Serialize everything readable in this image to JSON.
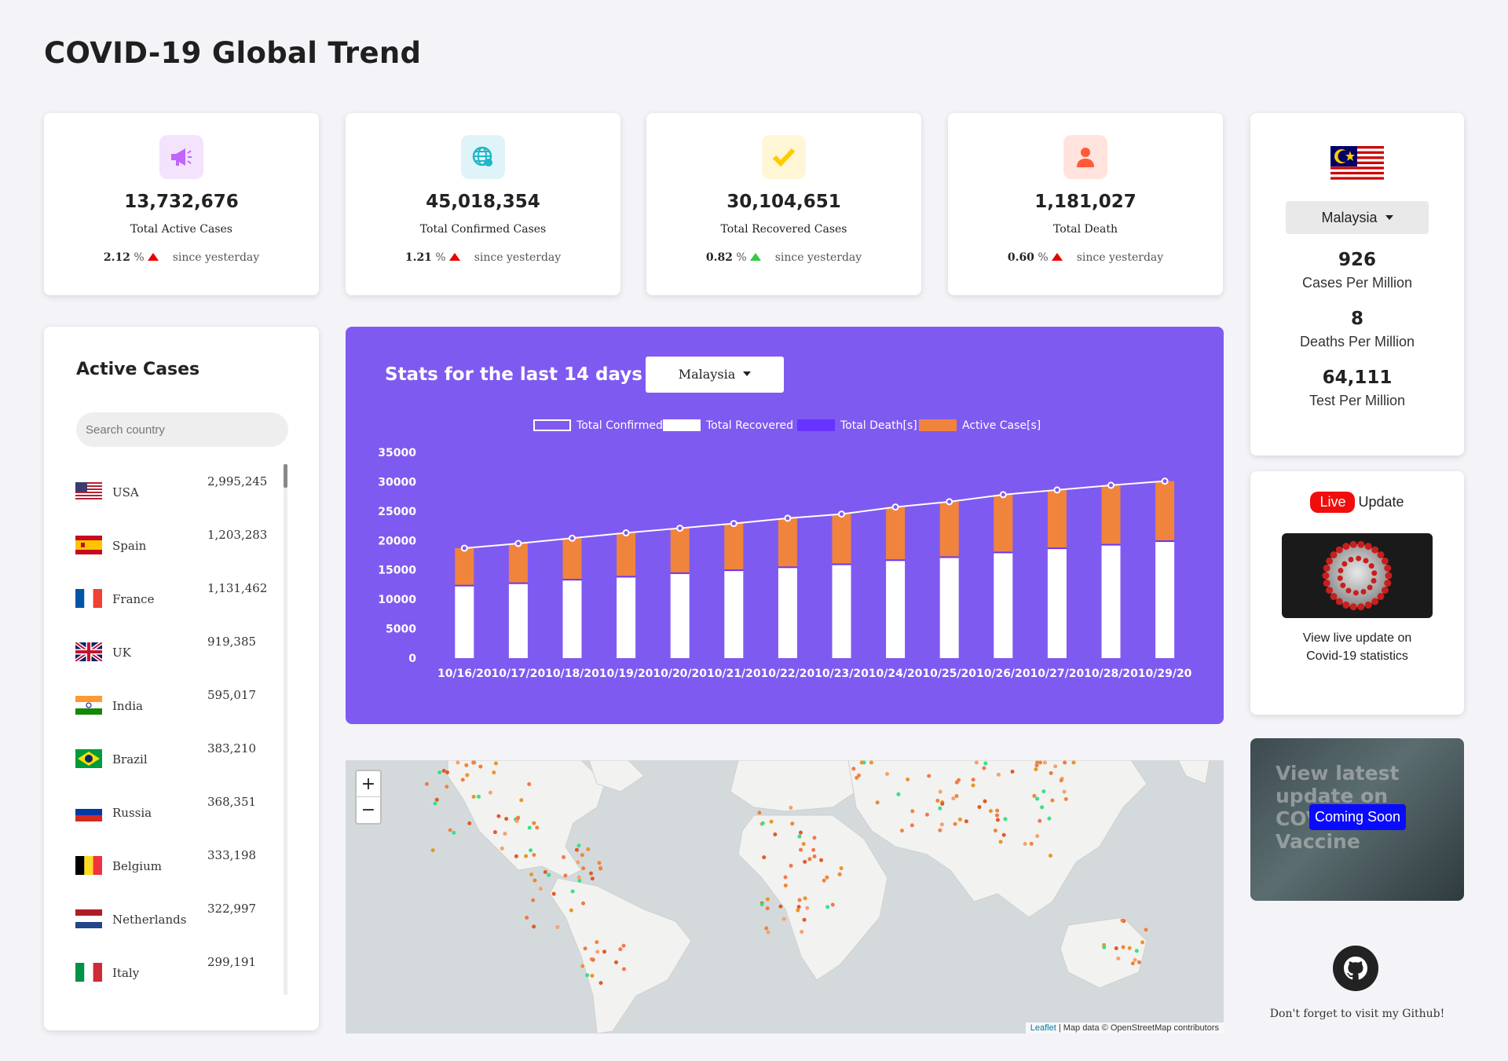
{
  "page_title": "COVID-19 Global Trend",
  "stats": [
    {
      "value": "13,732,676",
      "label": "Total Active Cases",
      "pct": "2.12",
      "since": "since yesterday",
      "icon": "megaphone-icon",
      "icon_color": "#c264fe",
      "icon_bg": "#f3e3fd",
      "trend_color": "#e60000"
    },
    {
      "value": "45,018,354",
      "label": "Total Confirmed Cases",
      "pct": "1.21",
      "since": "since yesterday",
      "icon": "globe-icon",
      "icon_color": "#1fb6c9",
      "icon_bg": "#dff4f8",
      "trend_color": "#e60000"
    },
    {
      "value": "30,104,651",
      "label": "Total Recovered Cases",
      "pct": "0.82",
      "since": "since yesterday",
      "icon": "check-icon",
      "icon_color": "#ffcc00",
      "icon_bg": "#fff6d6",
      "trend_color": "#2ecc40"
    },
    {
      "value": "1,181,027",
      "label": "Total Death",
      "pct": "0.60",
      "since": "since yesterday",
      "icon": "person-icon",
      "icon_color": "#ff5b3a",
      "icon_bg": "#ffe3dc",
      "trend_color": "#e60000"
    }
  ],
  "country_card": {
    "selected": "Malaysia",
    "cases_per_million": "926",
    "cases_label": "Cases Per Million",
    "deaths_per_million": "8",
    "deaths_label": "Deaths Per Million",
    "tests_per_million": "64,111",
    "tests_label": "Test Per Million"
  },
  "live": {
    "badge": "Live",
    "label": "Update",
    "line1": "View live update on",
    "line2": "Covid-19 statistics"
  },
  "vaccine": {
    "text_lines": [
      "View latest",
      "update on",
      "COVID-19",
      "Vaccine"
    ],
    "badge": "Coming Soon"
  },
  "github": {
    "text": "Don't forget to visit my Github!"
  },
  "active_cases": {
    "title": "Active Cases",
    "search_placeholder": "Search country",
    "rows": [
      {
        "country": "USA",
        "value": "2,995,245"
      },
      {
        "country": "Spain",
        "value": "1,203,283"
      },
      {
        "country": "France",
        "value": "1,131,462"
      },
      {
        "country": "UK",
        "value": "919,385"
      },
      {
        "country": "India",
        "value": "595,017"
      },
      {
        "country": "Brazil",
        "value": "383,210"
      },
      {
        "country": "Russia",
        "value": "368,351"
      },
      {
        "country": "Belgium",
        "value": "333,198"
      },
      {
        "country": "Netherlands",
        "value": "322,997"
      },
      {
        "country": "Italy",
        "value": "299,191"
      }
    ]
  },
  "chart_panel": {
    "title": "Stats for the last 14 days in",
    "selected": "Malaysia"
  },
  "chart_data": {
    "type": "bar",
    "categories": [
      "10/16/20",
      "10/17/20",
      "10/18/20",
      "10/19/20",
      "10/20/20",
      "10/21/20",
      "10/22/20",
      "10/23/20",
      "10/24/20",
      "10/25/20",
      "10/26/20",
      "10/27/20",
      "10/28/20",
      "10/29/20"
    ],
    "series": [
      {
        "name": "Total Confirmed",
        "kind": "line",
        "color": "#ffffff",
        "values": [
          18700,
          19500,
          20400,
          21300,
          22100,
          22900,
          23800,
          24500,
          25700,
          26600,
          27800,
          28600,
          29400,
          30100
        ]
      },
      {
        "name": "Total Recovered",
        "kind": "bar",
        "color": "#ffffff",
        "values": [
          12300,
          12700,
          13300,
          13800,
          14400,
          14900,
          15400,
          15900,
          16600,
          17100,
          17900,
          18600,
          19200,
          19800
        ]
      },
      {
        "name": "Total Death[s]",
        "kind": "bar",
        "color": "#6633ff",
        "values": [
          167,
          169,
          172,
          176,
          178,
          181,
          187,
          190,
          193,
          199,
          207,
          214,
          221,
          229
        ]
      },
      {
        "name": "Active Case[s]",
        "kind": "bar",
        "color": "#f0843c",
        "values": [
          6233,
          6631,
          6928,
          7324,
          7522,
          7819,
          8213,
          8410,
          8907,
          9301,
          9693,
          9786,
          9979,
          10071
        ]
      }
    ],
    "yticks": [
      "35000",
      "30000",
      "25000",
      "20000",
      "15000",
      "10000",
      "5000",
      "0"
    ],
    "ylim": [
      0,
      35000
    ],
    "legend": "top"
  },
  "map": {
    "zoom_in": "+",
    "zoom_out": "−",
    "attribution_link": "Leaflet",
    "attribution": " | Map data © OpenStreetMap contributors"
  }
}
